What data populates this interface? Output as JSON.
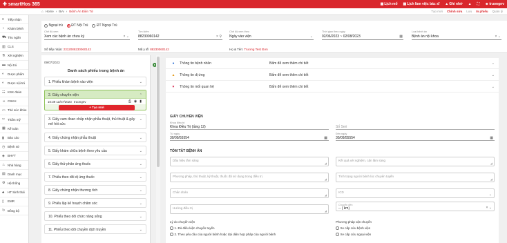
{
  "app": {
    "name": "smartHos 365"
  },
  "topbar": {
    "actions": [
      {
        "label": "Lịch mổ",
        "icon": "calendar-icon"
      },
      {
        "label": "Lịch làm việc bác sĩ",
        "icon": "calendar-icon"
      },
      {
        "label": "Ghi nhớ",
        "icon": "warning-icon"
      }
    ],
    "user": "truongnv"
  },
  "breadcrumb": {
    "items": [
      "Home",
      "Bvv",
      "Bệnh Án Điện Tử"
    ]
  },
  "subbar": {
    "actions": [
      "Tạo mới",
      "Chỉnh sửa",
      "Lưu",
      "In phiếu",
      "Quản lý"
    ]
  },
  "sidebar": {
    "items": [
      {
        "label": "Tiếp nhận",
        "icon": "list-icon"
      },
      {
        "label": "Khám bệnh",
        "icon": "stethoscope-icon"
      },
      {
        "label": "Thu ngân",
        "icon": "cart-icon"
      },
      {
        "label": "CLS",
        "icon": "lab-icon"
      },
      {
        "label": "Xét nghiệm",
        "icon": "flask-icon"
      },
      {
        "label": "Nội trú",
        "icon": "bed-icon"
      },
      {
        "label": "Dược phẩm",
        "icon": "pill-icon"
      },
      {
        "label": "Dược nội trú",
        "icon": "pill-icon"
      },
      {
        "label": "KSK đoàn",
        "icon": "group-icon"
      },
      {
        "label": "CSKH",
        "icon": "person-icon"
      },
      {
        "label": "Thẻ sức khỏe",
        "icon": "card-icon"
      },
      {
        "label": "Thẩm mỹ",
        "icon": "scissors-icon"
      },
      {
        "label": "Kế toán",
        "icon": "calc-icon"
      },
      {
        "label": "Báo cáo",
        "icon": "chart-icon"
      },
      {
        "label": "Bệnh sử",
        "icon": "history-icon"
      },
      {
        "label": "BHYT",
        "icon": "shield-icon"
      },
      {
        "label": "Nhà hàng",
        "icon": "food-icon"
      },
      {
        "label": "Danh mục",
        "icon": "folder-icon"
      },
      {
        "label": "Hệ thống",
        "icon": "gear-icon"
      },
      {
        "label": "HT Sinh thái",
        "icon": "tree-icon"
      },
      {
        "label": "EMR",
        "icon": "doc-icon"
      },
      {
        "label": "Đồng bộ",
        "icon": "sync-icon"
      }
    ]
  },
  "header_form": {
    "radios": [
      {
        "label": "Ngoại trú",
        "checked": false
      },
      {
        "label": "ĐT Nội Trú",
        "checked": true
      },
      {
        "label": "ĐT Ngoại Trú",
        "checked": false
      }
    ],
    "status": {
      "label": "Chế độ xem",
      "value": "Xem các bệnh án chưa ký"
    },
    "search": {
      "label": "Tìm kiếm",
      "value": "88230060142"
    },
    "view_mode": {
      "label": "Chế độ xem theo",
      "value": "Ngày vào viện"
    },
    "date_range": {
      "label": "Thời gian theo ngày",
      "value": "02/06/2023 ~ 02/08/2023"
    },
    "record_type": {
      "label": "Loại bệnh án",
      "value": "Bệnh án nội khoa"
    },
    "info": {
      "so_tiep_nhan_label": "Số tiếp nhận:",
      "so_tiep_nhan": "2312088230060142",
      "ma_y_te_label": "Mã y tế:",
      "ma_y_te": "88230060142",
      "ho_ten_label": "Họ & Tên:",
      "ho_ten": "Trương Test Đơn"
    }
  },
  "left_panel": {
    "date": "09/07/2023",
    "title": "Danh sách phiếu trong bệnh án",
    "docs": [
      "1. Phiếu khám bệnh vào viện",
      "2. Giấy chuyển viện",
      "3. Giấy cam đoan chấp nhận phẫu thuật, thủ thuật & gây mê hồi sức",
      "4. Giấy chứng nhận phẫu thuật",
      "5. Giấy khám chữa bệnh theo yêu cầu",
      "6. Giấy thử phản ứng thuốc",
      "7. Phiếu theo dõi dị ứng thuốc",
      "8. Giấy chứng nhận thương tích",
      "9. Phiếu lập kế hoạch chăm sóc",
      "10. Phiếu theo dõi chức năng sống",
      "11. Phiếu theo dõi chuyền dịch truyền"
    ],
    "selected_sub": {
      "time": "10:39 11/07/2023",
      "user": "truongnv"
    },
    "new_button": "+ Tạo mới"
  },
  "right_panel": {
    "accordions": [
      {
        "title": "Thông tin bệnh nhân",
        "hint": "Bấm để xem thêm chi tiết",
        "icon": "info-icon",
        "color": "#2a6fd6"
      },
      {
        "title": "Thông tin dị ứng",
        "hint": "Bấm để xem thêm chi tiết",
        "icon": "warning-icon",
        "color": "#e39b1b"
      },
      {
        "title": "Thông tin mối quan hệ",
        "hint": "Bấm để xem thêm chi tiết",
        "icon": "heart-icon",
        "color": "#d6264d"
      }
    ],
    "section_title": "GIẤY CHUYỂN VIỆN",
    "khoa": {
      "label": "Khoa điều trị",
      "value": "Khoa Điều Trị (tầng 12)"
    },
    "so_seri": {
      "placeholder": "Số Seri"
    },
    "tu_ngay": {
      "label": "Từ ngày",
      "value": "30/09/55554"
    },
    "den_ngay": {
      "label": "Đến ngày",
      "value": "30/09/55554"
    },
    "summary_title": "TÓM TẮT BỆNH ÁN",
    "dau_hieu": "Dấu hiệu lâm sàng",
    "ket_qua": "Kết quả xét nghiệm, cận lâm sàng",
    "phuong_phap": "Phương pháp, thủ thuật, kỹ thuật, thuốc đã sử dụng trong điều trị",
    "tinh_trang": "Tình trạng người bệnh lúc chuyển tuyến",
    "chan_doan": "Chẩn đoán",
    "icd": "ICD",
    "huong_dieu_tri": "Hướng điều trị",
    "chuyen_den": {
      "label": "Chuyển đến",
      "value": "-- ( km)"
    },
    "ly_do_label": "Lý do chuyển viện",
    "ly_do_options": [
      "1. Đủ điều kiện chuyển tuyến",
      "2. Theo yêu cầu của người bệnh hoặc đại diện hợp pháp của người bệnh"
    ],
    "phuong_tien_label": "Phương pháp vận chuyển",
    "phuong_tien_options": [
      "Xe cấp cứu bệnh viện",
      "Xe cấp cứu ngoại viện"
    ]
  },
  "colors": {
    "brand": "#d9262c",
    "selected_doc": "#d6ebc2"
  }
}
